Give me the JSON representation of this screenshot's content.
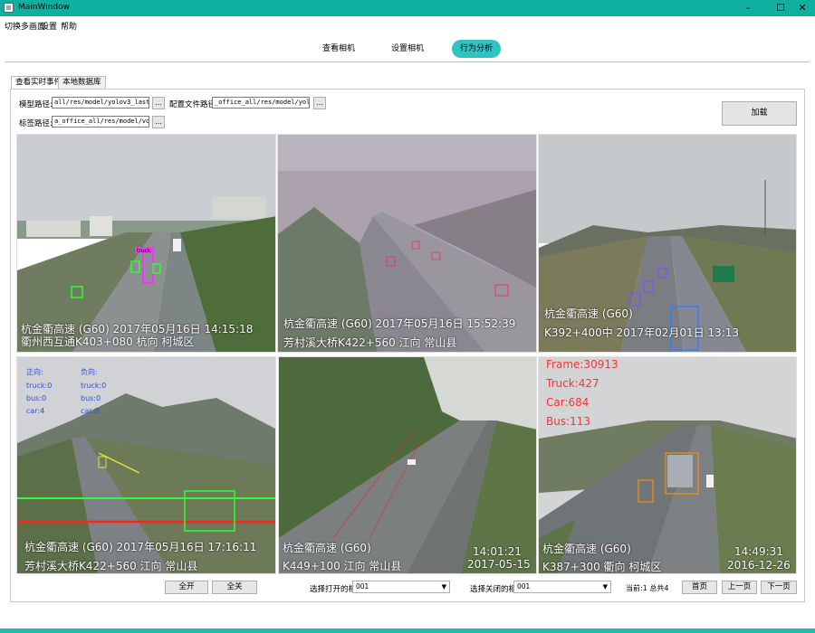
{
  "window": {
    "title": "MainWindow",
    "minimize": "–",
    "maximize": "☐",
    "close": "✕"
  },
  "menu": [
    "切换多画面",
    "设置",
    "帮助"
  ],
  "nav": [
    "查看相机",
    "设置相机",
    "行为分析"
  ],
  "tabs": [
    "查看实时事件",
    "本地数据库"
  ],
  "form": {
    "model_label": "模型路径:",
    "model_value": "all/res/model/yolov3_last.weights",
    "config_label": "配置文件路径:",
    "config_value": "_office_all/res/model/yolov3.cfg",
    "tags_label": "标签路径:",
    "tags_value": "a_office_all/res/model/voc.names",
    "browse": "...",
    "load": "加载"
  },
  "cameras": [
    {
      "line1": "杭金衢高速 (G60) 2017年05月16日  14:15:18",
      "line2": "衢州西互通K403+080 杭向 柯城区"
    },
    {
      "line1": "杭金衢高速 (G60) 2017年05月16日  15:52:39",
      "line2": "芳村溪大桥K422+560 江向 常山县"
    },
    {
      "line1": "杭金衢高速 (G60)",
      "line2": "K392+400中 2017年02月01日  13:13"
    },
    {
      "line1": "杭金衢高速 (G60) 2017年05月16日  17:16:11",
      "line2": "芳村溪大桥K422+560 江向 常山县",
      "stats_left": [
        "正向:",
        "truck:0",
        "bus:0",
        "car:4"
      ],
      "stats_right": [
        "负向:",
        "truck:0",
        "bus:0",
        "car:0"
      ]
    },
    {
      "line1": "杭金衢高速 (G60)",
      "line2": "K449+100 江向 常山县",
      "time": "14:01:21",
      "date": "2017-05-15"
    },
    {
      "line1": "杭金衢高速 (G60)",
      "line2": "K387+300 衢向 柯城区",
      "time": "14:49:31",
      "date": "2016-12-26",
      "counts": [
        "Frame:30913",
        "Truck:427",
        "Car:684",
        "Bus:113"
      ]
    }
  ],
  "detections": [
    "truck",
    "car",
    "car",
    "car",
    "car"
  ],
  "bottom": {
    "open_all": "全开",
    "close_all": "全关",
    "open_label": "选择打开的相机",
    "open_value": "001",
    "close_label": "选择关闭的相机",
    "close_value": "001",
    "page_info": "当前:1  总共4",
    "first": "首页",
    "prev": "上一页",
    "next": "下一页"
  },
  "colors": {
    "titlebar": "#0fb0a0",
    "active_nav": "#2ec4c4"
  }
}
